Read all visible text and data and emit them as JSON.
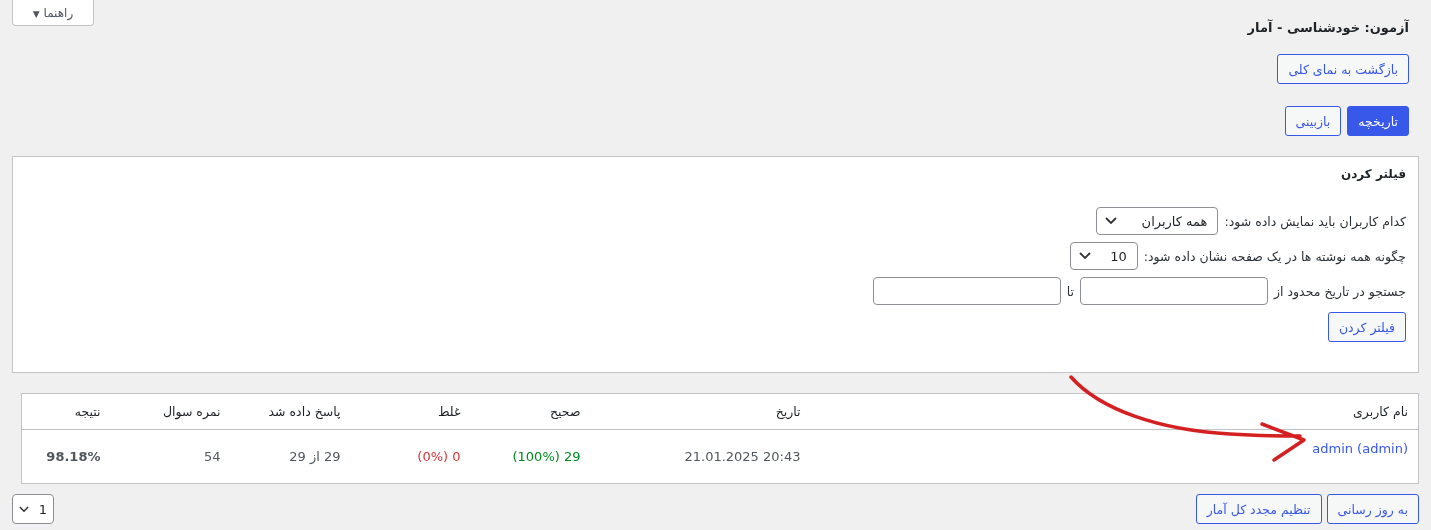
{
  "help_button": {
    "label": "راهنما",
    "caret": "▼"
  },
  "title": "آزمون: خودشناسی - آمار",
  "back_button": "بازگشت به نمای کلی",
  "tabs": [
    {
      "label": "تاریخچه",
      "selected": true
    },
    {
      "label": "بازبینی",
      "selected": false
    }
  ],
  "filter": {
    "title": "فیلتر کردن",
    "users_label": "کدام کاربران باید نمایش داده شود:",
    "users_value": "همه کاربران",
    "per_page_label": "چگونه همه نوشته ها در یک صفحه نشان داده شود:",
    "per_page_value": "10",
    "date_label": "جستجو در تاریخ محدود از",
    "date_to_label": "تا",
    "button": "فیلتر کردن"
  },
  "table": {
    "columns": [
      "نام کاربری",
      "تاریخ",
      "صحیح",
      "غلط",
      "پاسخ داده شد",
      "نمره سوال",
      "نتیجه"
    ],
    "rows": [
      {
        "user": "admin (admin)",
        "date": "20:43 21.01.2025",
        "correct": "29 (100%)",
        "wrong": "0 (0%)",
        "answered": "29 از 29",
        "points": "54",
        "result": "98.18%"
      }
    ]
  },
  "footer": {
    "buttons": [
      "به روز رسانی",
      "تنظیم مجدد کل آمار"
    ],
    "page_value": "1"
  }
}
